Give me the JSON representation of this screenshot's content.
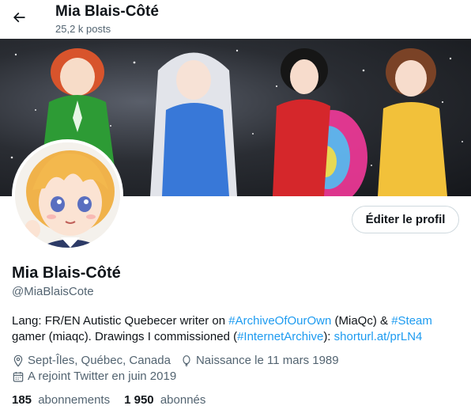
{
  "header": {
    "name": "Mia Blais-Côté",
    "posts_count": "25,2 k posts"
  },
  "profile": {
    "edit_button_label": "Éditer le profil",
    "display_name": "Mia Blais-Côté",
    "handle": "@MiaBlaisCote"
  },
  "bio": {
    "line1_a": "Lang: FR/EN Autistic Quebecer writer on ",
    "link_archive": "#ArchiveOfOurOwn",
    "line1_b": " (MiaQc) & ",
    "link_steam": "#Steam",
    "line2_a": "gamer (miaqc). Drawings I commissioned (",
    "link_internet_archive": "#InternetArchive",
    "line2_b": "): ",
    "link_short": "shorturl.at/prLN4"
  },
  "meta": {
    "location": "Sept-Îles, Québec, Canada",
    "birthday": "Naissance le 11 mars 1989",
    "joined": "A rejoint Twitter en juin 2019"
  },
  "stats": {
    "following_count": "185",
    "following_label": "abonnements",
    "followers_count": "1 950",
    "followers_label": "abonnés"
  },
  "colors": {
    "accent": "#1d9bf0",
    "secondary_text": "#536471",
    "primary_text": "#0f1419"
  }
}
